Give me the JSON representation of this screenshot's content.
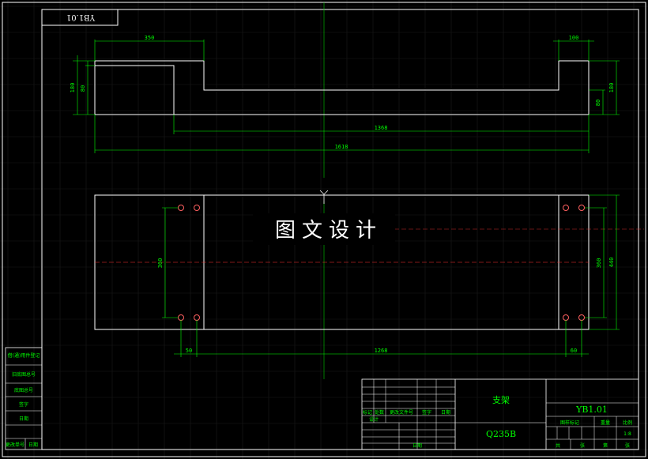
{
  "corner_label": "YB1.01",
  "watermark": "图文设计",
  "top_view": {
    "dims": {
      "top_left_width": "350",
      "top_right_width": "100",
      "left_height_outer": "180",
      "left_height_inner": "80",
      "right_height_outer": "180",
      "right_height_inner": "80",
      "inner_length": "1368",
      "total_length": "1618"
    }
  },
  "bottom_view": {
    "dims": {
      "left_hole_spacing": "360",
      "right_hole_spacing": "360",
      "overall_height": "440",
      "left_edge_offset": "50",
      "hole_span": "1268",
      "right_edge_offset": "60"
    }
  },
  "side_table": {
    "rows": [
      "借(通)用件登记",
      "旧底图总号",
      "底图总号",
      "签字",
      "日期",
      "更改单号",
      "日期"
    ]
  },
  "title_block": {
    "part_name": "支架",
    "material": "Q235B",
    "drawing_number": "YB1.01",
    "header_cells": [
      "标记",
      "处数",
      "更改文件号",
      "签字",
      "日期"
    ],
    "design_label": "设计",
    "sign_labels": [
      "图样标记",
      "重量",
      "比例"
    ],
    "scale": "1:8",
    "sheet_labels": [
      "共",
      "张",
      "第",
      "张"
    ],
    "date_label": "日期"
  }
}
